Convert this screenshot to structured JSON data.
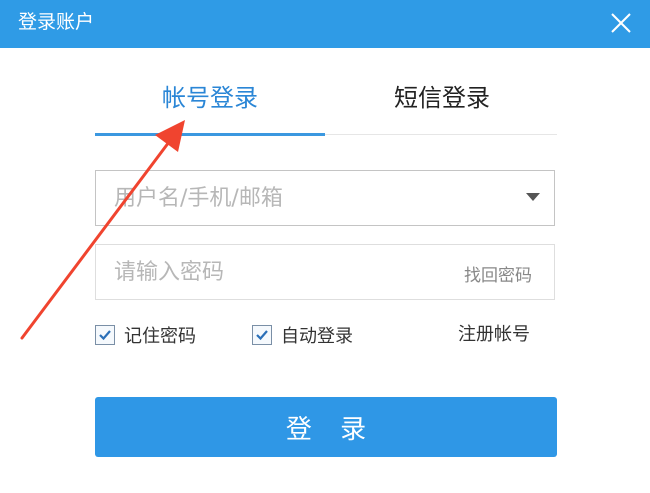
{
  "window": {
    "title": "登录账户",
    "close_icon": "close-icon"
  },
  "tabs": [
    {
      "label": "帐号登录",
      "active": true
    },
    {
      "label": "短信登录",
      "active": false
    }
  ],
  "form": {
    "username_placeholder": "用户名/手机/邮箱",
    "username_value": "",
    "password_placeholder": "请输入密码",
    "password_value": "",
    "forgot_password": "找回密码",
    "remember_password": {
      "label": "记住密码",
      "checked": true
    },
    "auto_login": {
      "label": "自动登录",
      "checked": true
    },
    "register": "注册帐号",
    "login_button": "登 录"
  },
  "colors": {
    "accent": "#2f97e6",
    "active_tab_text": "#2a86d6",
    "annotation_arrow": "#f0442f"
  }
}
